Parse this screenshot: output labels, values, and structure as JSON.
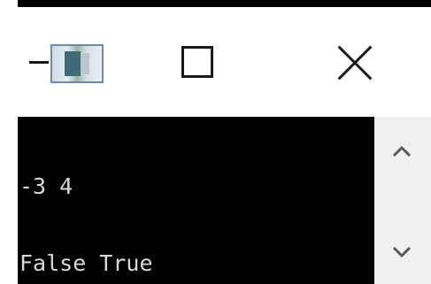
{
  "window": {
    "controls": {
      "minimize_icon": "minimize-icon",
      "maximize_icon": "maximize-icon",
      "close_icon": "close-icon"
    }
  },
  "console": {
    "lines": [
      "-3 4",
      "False True"
    ],
    "background": "#000000",
    "foreground": "#d8d8d8"
  },
  "scrollbar": {
    "up_icon": "chevron-up-icon",
    "down_icon": "chevron-down-icon"
  }
}
